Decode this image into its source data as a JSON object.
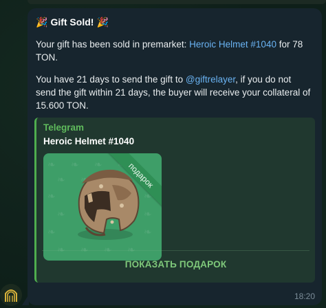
{
  "message": {
    "title": "Gift Sold!",
    "para1_prefix": "Your gift has been sold in premarket: ",
    "para1_link": "Heroic Helmet #1040",
    "para1_suffix": " for 78 TON.",
    "para2_prefix": "You have 21 days to send the gift to ",
    "para2_link": "@giftrelayer",
    "para2_suffix": ", if you do not send the gift within 21 days, the buyer will receive your collateral of 15.600 TON.",
    "time": "18:20"
  },
  "embed": {
    "source": "Telegram",
    "title": "Heroic Helmet #1040",
    "ribbon": "подарок",
    "action_label": "ПОКАЗАТЬ ПОДАРОК"
  },
  "colors": {
    "bubble": "#17252e",
    "link": "#6ab3f3",
    "accent_green": "#4fae4e",
    "gift_bg": "#3e9e68"
  },
  "icons": {
    "title_left": "party-popper-icon",
    "title_right": "party-popper-icon",
    "avatar": "bot-avatar-icon",
    "gift": "helmet-icon"
  }
}
